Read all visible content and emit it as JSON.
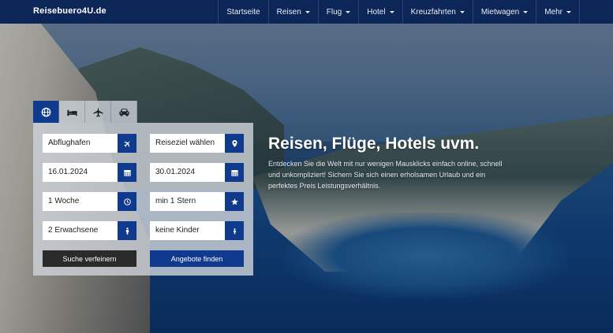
{
  "brand": "Reisebuero4U.de",
  "nav": [
    {
      "label": "Startseite",
      "dropdown": false
    },
    {
      "label": "Reisen",
      "dropdown": true
    },
    {
      "label": "Flug",
      "dropdown": true
    },
    {
      "label": "Hotel",
      "dropdown": true
    },
    {
      "label": "Kreuzfahrten",
      "dropdown": true
    },
    {
      "label": "Mietwagen",
      "dropdown": true
    },
    {
      "label": "Mehr",
      "dropdown": true
    }
  ],
  "tabs": [
    {
      "icon": "globe-icon",
      "active": true
    },
    {
      "icon": "bed-icon",
      "active": false
    },
    {
      "icon": "plane-icon",
      "active": false
    },
    {
      "icon": "car-icon",
      "active": false
    }
  ],
  "search": {
    "departure": "Abflughafen",
    "destination": "Reiseziel wählen",
    "date_from": "16.01.2024",
    "date_to": "30.01.2024",
    "duration": "1 Woche",
    "stars": "min 1 Stern",
    "adults": "2 Erwachsene",
    "children": "keine Kinder",
    "refine_label": "Suche verfeinern",
    "find_label": "Angebote finden"
  },
  "hero": {
    "headline": "Reisen, Flüge, Hotels uvm.",
    "lead": "Entdecken Sie die Welt mit nur wenigen Mausklicks einfach online, schnell und unkompliziert! Sichern Sie sich einen erholsamen Urlaub und ein perfektes Preis Leistungsverhältnis."
  },
  "colors": {
    "navbar": "#0c2657",
    "accent": "#0f3a8e",
    "dark_button": "#2b2b2b"
  }
}
